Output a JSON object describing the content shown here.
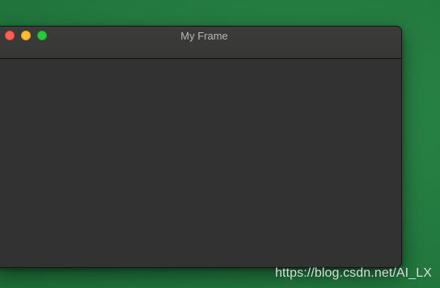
{
  "window": {
    "title": "My Frame"
  },
  "watermark": {
    "text": "https://blog.csdn.net/AI_LX"
  },
  "colors": {
    "desktop": "#237a40",
    "window_body": "#323232",
    "titlebar": "#3a3b39",
    "close": "#fe5f57",
    "minimize": "#febc2e",
    "maximize": "#28c840"
  }
}
